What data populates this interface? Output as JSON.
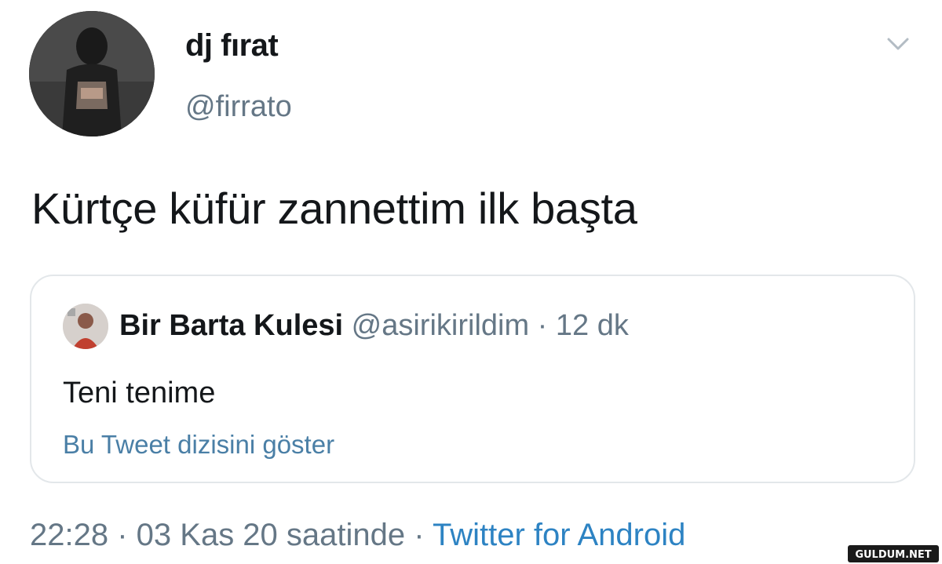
{
  "tweet": {
    "display_name": "dj fırat",
    "handle": "@firrato",
    "text": "Kürtçe küfür zannettim ilk başta"
  },
  "quoted_tweet": {
    "display_name": "Bir Barta Kulesi",
    "handle": "@asirikirildim",
    "separator": " · ",
    "time": "12 dk",
    "text": "Teni tenime",
    "show_thread_link": "Bu Tweet dizisini göster"
  },
  "footer": {
    "time": "22:28",
    "separator1": " · ",
    "date_text": "03 Kas 20 saatinde",
    "separator2": " · ",
    "source": "Twitter for Android"
  },
  "watermark": {
    "text": "GULDUM.NET"
  },
  "colors": {
    "name": "#14171a",
    "secondary": "#657786",
    "link": "#4a7fa6",
    "source_link": "#2d83c3",
    "card_border": "#e3e7ea"
  },
  "icons": {
    "menu": "chevron-down-icon"
  }
}
